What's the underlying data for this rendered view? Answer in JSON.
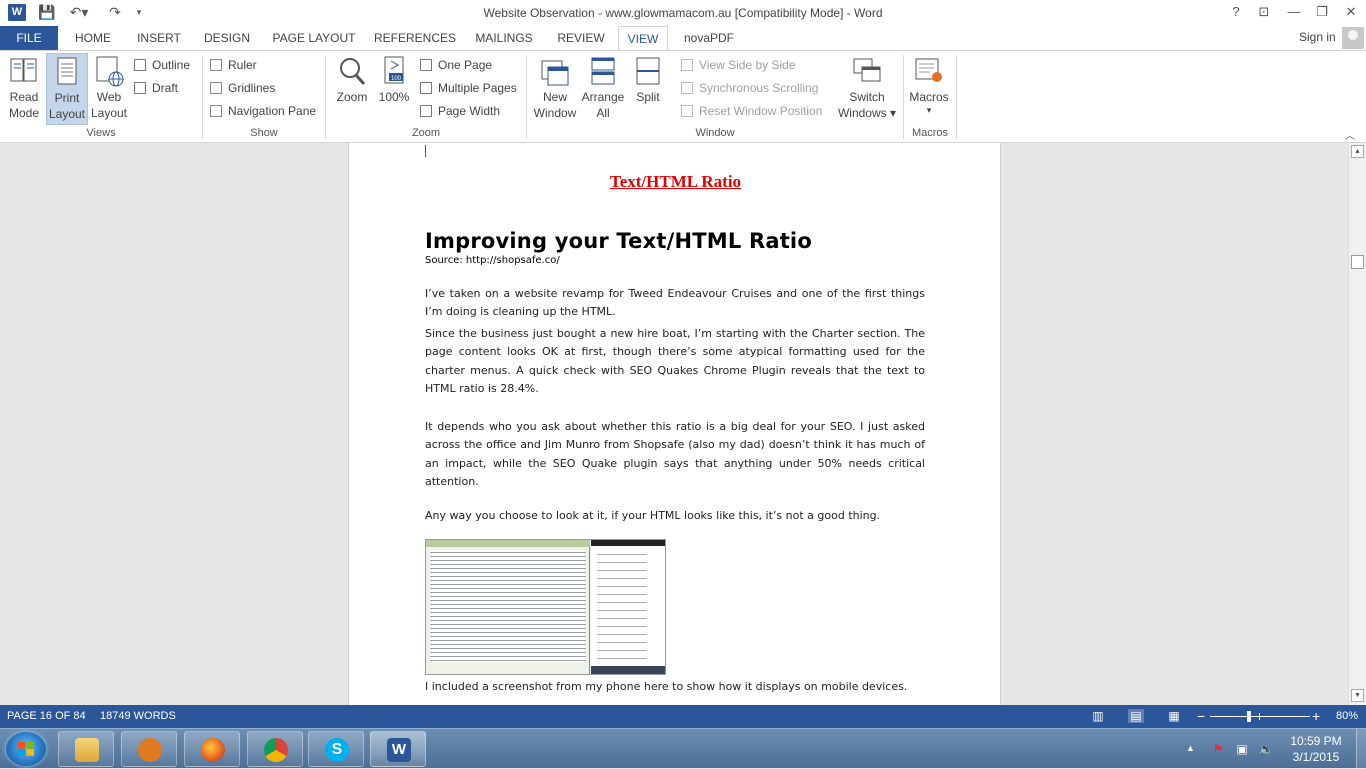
{
  "window": {
    "title": "Website Observation - www.glowmamacom.au [Compatibility Mode] - Word",
    "help": "?",
    "app_icon_letter": "W"
  },
  "tabs": [
    "FILE",
    "HOME",
    "INSERT",
    "DESIGN",
    "PAGE LAYOUT",
    "REFERENCES",
    "MAILINGS",
    "REVIEW",
    "VIEW",
    "novaPDF"
  ],
  "active_tab": "VIEW",
  "account": {
    "sign_in": "Sign in"
  },
  "ribbon": {
    "views": {
      "group_label": "Views",
      "read_mode": [
        "Read",
        "Mode"
      ],
      "print_layout": [
        "Print",
        "Layout"
      ],
      "web_layout": [
        "Web",
        "Layout"
      ],
      "outline": "Outline",
      "draft": "Draft"
    },
    "show": {
      "group_label": "Show",
      "ruler": "Ruler",
      "gridlines": "Gridlines",
      "navigation_pane": "Navigation Pane"
    },
    "zoom": {
      "group_label": "Zoom",
      "zoom": "Zoom",
      "hundred": "100%",
      "one_page": "One Page",
      "multiple_pages": "Multiple Pages",
      "page_width": "Page Width"
    },
    "window": {
      "group_label": "Window",
      "new_window": [
        "New",
        "Window"
      ],
      "arrange_all": [
        "Arrange",
        "All"
      ],
      "split": "Split",
      "side_by_side": "View Side by Side",
      "sync_scroll": "Synchronous Scrolling",
      "reset_pos": "Reset Window Position",
      "switch_windows": [
        "Switch",
        "Windows ▾"
      ]
    },
    "macros": {
      "group_label": "Macros",
      "macros": "Macros",
      "arrow": "▾"
    }
  },
  "document": {
    "page_title": "Text/HTML Ratio",
    "heading": "Improving your Text/HTML Ratio",
    "source": "Source: http://shopsafe.co/",
    "p1": "I’ve taken on a website revamp for Tweed Endeavour Cruises and one of the first things I’m doing is cleaning up the HTML.",
    "p2": "Since the business just bought a new hire boat, I’m starting with the Charter section. The page content looks OK at first, though there’s some atypical formatting used for the charter menus. A quick check with SEO Quakes Chrome Plugin reveals that the text to HTML ratio is 28.4%.",
    "p3": "It depends who you ask about whether this ratio is a big deal for your SEO. I just asked across the office and Jim Munro from Shopsafe (also my dad) doesn’t think it has much of an impact, while the SEO Quake plugin says that anything under 50% needs critical attention.",
    "p4": "Any way you choose to look at it, if your HTML looks like this, it’s not a good thing.",
    "p5": "I included a screenshot from my phone here to show how it displays on mobile devices."
  },
  "status": {
    "page": "PAGE 16 OF 84",
    "words": "18749 WORDS",
    "zoom_percent": "80%",
    "minus": "−",
    "plus": "+"
  },
  "taskbar": {
    "time": "10:59 PM",
    "date": "3/1/2015",
    "apps": [
      "file-explorer",
      "media-player",
      "firefox",
      "chrome",
      "skype",
      "word"
    ]
  },
  "colors": {
    "accent": "#2b579a",
    "heading_red": "#e00000"
  }
}
